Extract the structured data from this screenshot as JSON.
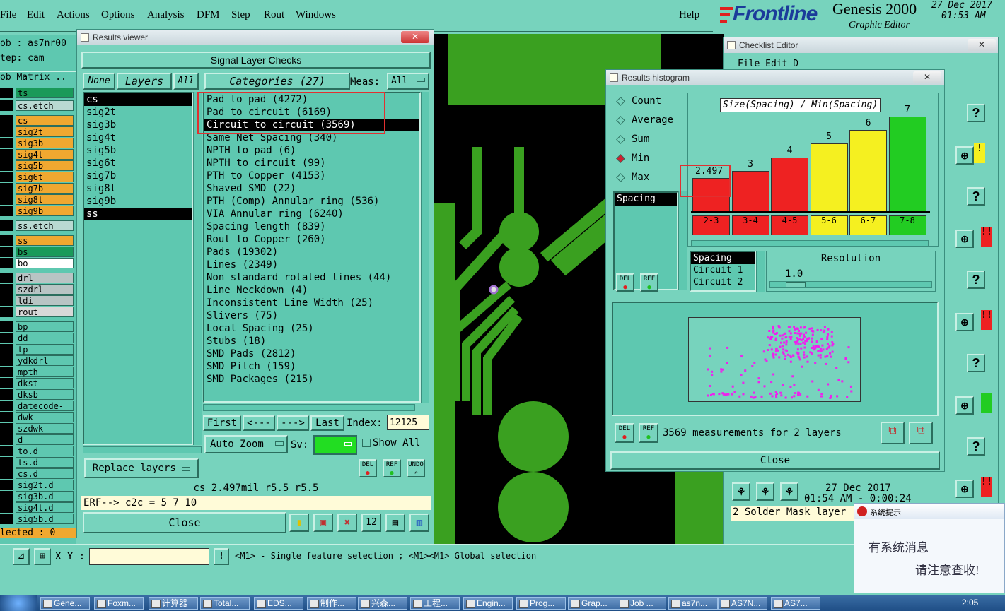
{
  "menu": {
    "items": [
      "File",
      "Edit",
      "Actions",
      "Options",
      "Analysis",
      "DFM",
      "Step",
      "Rout",
      "Windows"
    ],
    "help": "Help"
  },
  "brand": {
    "logo": "Frontline",
    "app": "Genesis 2000",
    "subtitle": "Graphic Editor",
    "date": "27 Dec 2017",
    "time": "01:53 AM"
  },
  "left": {
    "job": "ob : as7nr00",
    "step": "tep: cam",
    "matrix": "ob Matrix ..",
    "layers": [
      {
        "name": "ts",
        "color": "#1a9a5a"
      },
      {
        "name": "cs.etch",
        "color": "#b9d9d2"
      },
      {
        "name": "cs",
        "color": "#f0a830"
      },
      {
        "name": "sig2t",
        "color": "#f0a830"
      },
      {
        "name": "sig3b",
        "color": "#f0a830"
      },
      {
        "name": "sig4t",
        "color": "#f0a830"
      },
      {
        "name": "sig5b",
        "color": "#f0a830"
      },
      {
        "name": "sig6t",
        "color": "#f0a830"
      },
      {
        "name": "sig7b",
        "color": "#f0a830"
      },
      {
        "name": "sig8t",
        "color": "#f0a830"
      },
      {
        "name": "sig9b",
        "color": "#f0a830"
      },
      {
        "name": "ss.etch",
        "color": "#b9d9d2"
      },
      {
        "name": "ss",
        "color": "#f0a830"
      },
      {
        "name": "bs",
        "color": "#1a9a5a"
      },
      {
        "name": "bo",
        "color": "#ffffff"
      },
      {
        "name": "drl",
        "color": "#b8c4c4"
      },
      {
        "name": "szdrl",
        "color": "#b8c4c4"
      },
      {
        "name": "ldi",
        "color": "#b8c4c4"
      },
      {
        "name": "rout",
        "color": "#d8d8d8"
      },
      {
        "name": "bp",
        "color": "#5ec8b0"
      },
      {
        "name": "dd",
        "color": "#5ec8b0"
      },
      {
        "name": "tp",
        "color": "#5ec8b0"
      },
      {
        "name": "ydkdrl",
        "color": "#5ec8b0"
      },
      {
        "name": "mpth",
        "color": "#5ec8b0"
      },
      {
        "name": "dkst",
        "color": "#5ec8b0"
      },
      {
        "name": "dksb",
        "color": "#5ec8b0"
      },
      {
        "name": "datecode-to",
        "color": "#5ec8b0"
      },
      {
        "name": "dwk",
        "color": "#5ec8b0"
      },
      {
        "name": "szdwk",
        "color": "#5ec8b0"
      },
      {
        "name": "d",
        "color": "#5ec8b0"
      },
      {
        "name": "to.d",
        "color": "#5ec8b0"
      },
      {
        "name": "ts.d",
        "color": "#5ec8b0"
      },
      {
        "name": "cs.d",
        "color": "#5ec8b0"
      },
      {
        "name": "sig2t.d",
        "color": "#5ec8b0"
      },
      {
        "name": "sig3b.d",
        "color": "#5ec8b0"
      },
      {
        "name": "sig4t.d",
        "color": "#5ec8b0"
      },
      {
        "name": "sig5b.d",
        "color": "#5ec8b0"
      }
    ],
    "selected": "lected : 0"
  },
  "results_viewer": {
    "title": "Results viewer",
    "close_x": "✕",
    "heading": "Signal Layer Checks",
    "none": "None",
    "layers_label": "Layers",
    "all": "All",
    "categories_label": "Categories (27)",
    "meas_label": "Meas:",
    "meas_value": "All",
    "layer_list": [
      "cs",
      "sig2t",
      "sig3b",
      "sig4t",
      "sig5b",
      "sig6t",
      "sig7b",
      "sig8t",
      "sig9b",
      "ss"
    ],
    "categories": [
      "Pad to pad (4272)",
      "Pad to circuit (6169)",
      "Circuit to circuit (3569)",
      "Same Net Spacing (340)",
      "NPTH to pad (6)",
      "NPTH to circuit (99)",
      "PTH to Copper (4153)",
      "Shaved SMD (22)",
      "PTH (Comp) Annular ring (536)",
      "VIA Annular ring (6240)",
      "Spacing length (839)",
      "Rout to Copper (260)",
      "Pads (19302)",
      "Lines (2349)",
      "Non standard rotated lines (44)",
      "Line Neckdown (4)",
      "Inconsistent Line Width (25)",
      "Slivers (75)",
      "Local Spacing (25)",
      "Stubs (18)",
      "SMD Pads (2812)",
      "SMD Pitch (159)",
      "SMD Packages (215)"
    ],
    "nav": {
      "first": "First",
      "prev": "<---",
      "next": "--->",
      "last": "Last",
      "index_label": "Index:",
      "index_value": "12125"
    },
    "replace_layers": "Replace layers",
    "auto_zoom": "Auto Zoom",
    "sv": "Sv:",
    "show_all": "Show All",
    "del": "DEL",
    "ref": "REF",
    "undo": "UNDO",
    "status": "cs 2.497mil  r5.5  r5.5",
    "erf": "ERF--> c2c = 5 7 10",
    "close": "Close"
  },
  "histogram": {
    "title": "Results histogram",
    "modes": [
      "Count",
      "Average",
      "Sum",
      "Min",
      "Max"
    ],
    "selected_mode": "Min",
    "chart_title": "Size(Spacing) / Min(Spacing)",
    "meas_list": [
      "Spacing"
    ],
    "del": "DEL",
    "ref": "REF",
    "resolution_label": "Resolution",
    "resolution_value": "1.0",
    "attr_list": [
      "Spacing",
      "Circuit 1",
      "Circuit 2"
    ],
    "summary": "3569 measurements for 2 layers",
    "close": "Close"
  },
  "chart_data": {
    "type": "bar",
    "title": "Size(Spacing) / Min(Spacing)",
    "categories": [
      "2-3",
      "3-4",
      "4-5",
      "5-6",
      "6-7",
      "7-8"
    ],
    "values": [
      2.497,
      3,
      4,
      5,
      6,
      7
    ],
    "value_labels": [
      "2.497",
      "3",
      "4",
      "5",
      "6",
      "7"
    ],
    "colors": [
      "#ee2222",
      "#ee2222",
      "#ee2222",
      "#f5f020",
      "#f5f020",
      "#22cc22"
    ],
    "ylim": [
      0,
      8
    ]
  },
  "checklist": {
    "title": "Checklist Editor",
    "menu": "File  Edit  D",
    "date": "27 Dec 2017",
    "time": "01:54 AM  - 0:00:24",
    "note": "2 Solder Mask layer"
  },
  "bottom": {
    "xy_label": "X Y :",
    "hint": "<M1> - Single feature selection ; <M1><M1> Global selection"
  },
  "popup": {
    "title": "系统提示",
    "line1": "有系统消息",
    "line2": "请注意查收!"
  },
  "taskbar": {
    "tasks": [
      "Gene...",
      "Foxm...",
      "计算器",
      "Total...",
      "EDS...",
      "制作...",
      "兴森...",
      "工程...",
      "Engin...",
      "Prog...",
      "Grap...",
      "Job ...",
      "as7n...",
      "AS7N...",
      "AS7..."
    ],
    "clock": "2:05"
  }
}
